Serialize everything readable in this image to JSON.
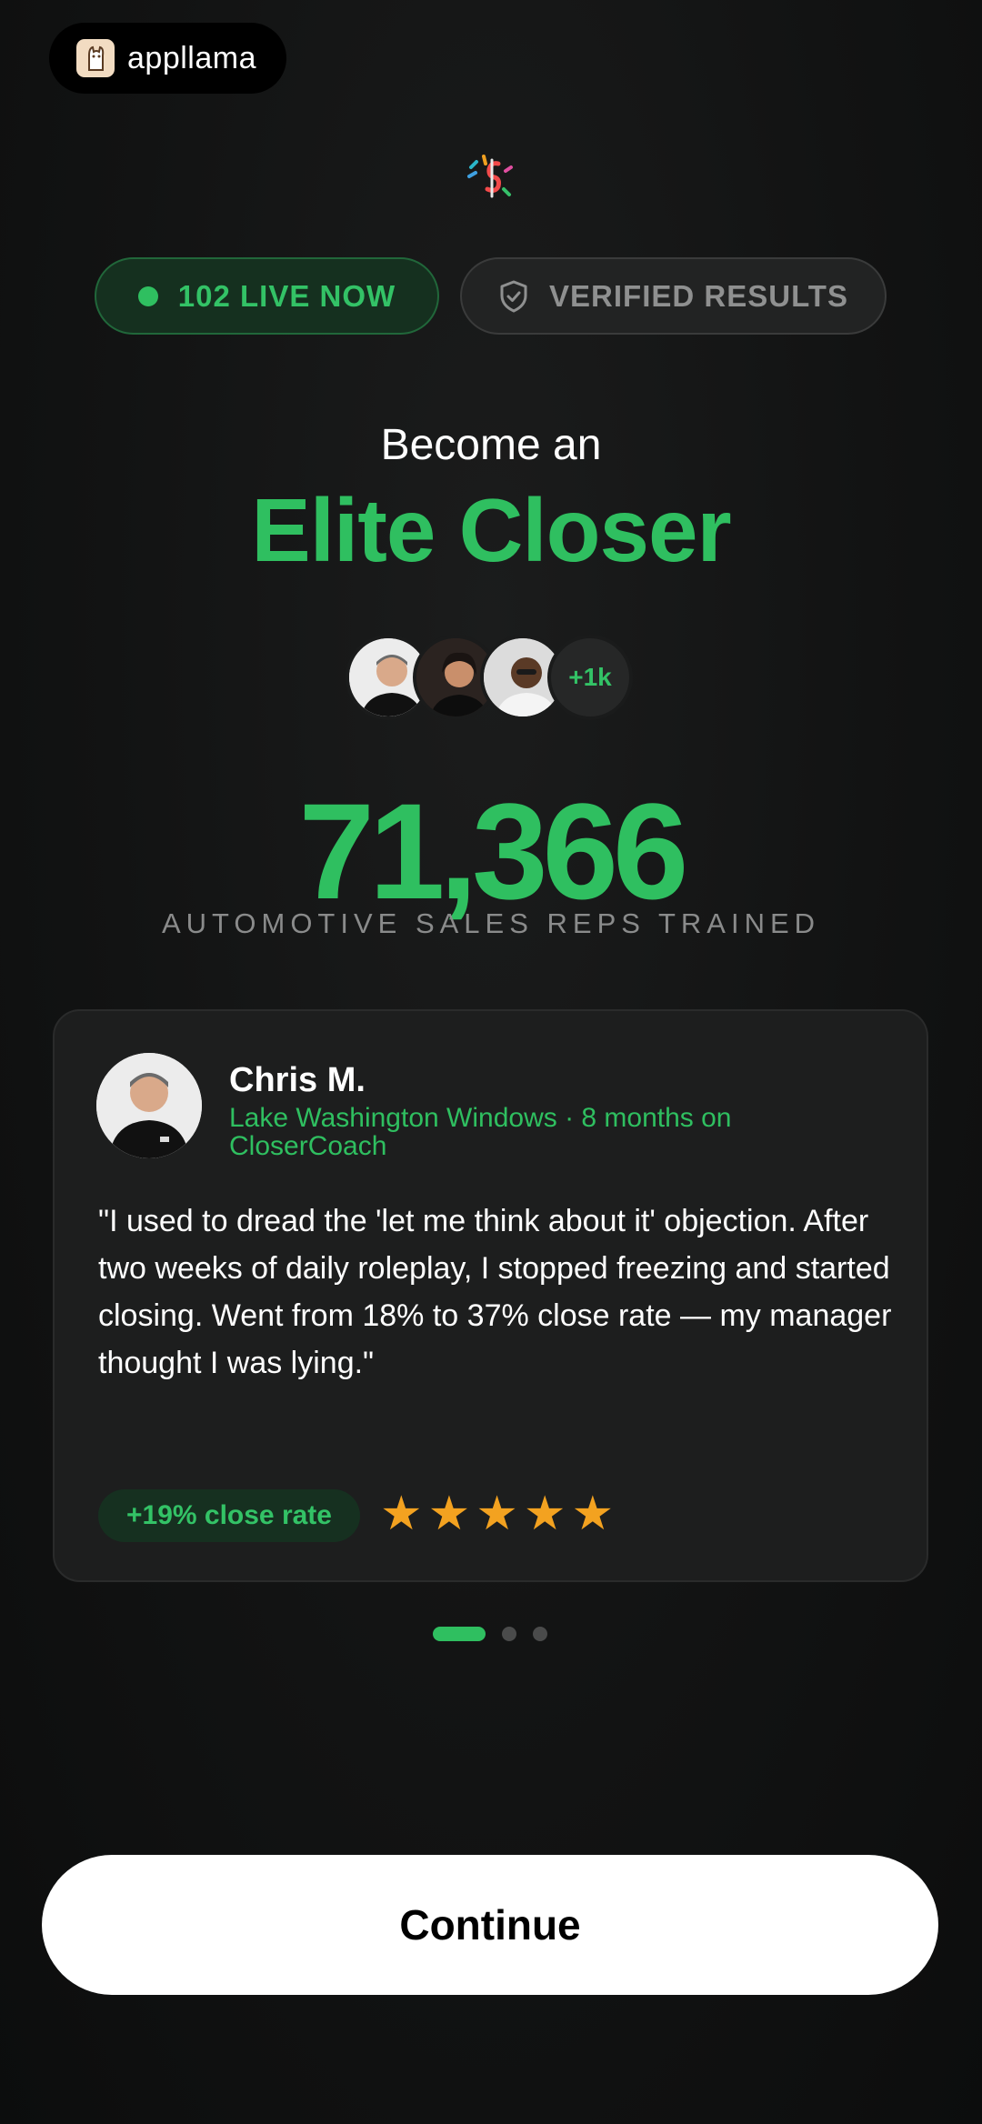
{
  "brand": {
    "name": "appllama"
  },
  "badges": {
    "live": "102 LIVE NOW",
    "verified": "VERIFIED RESULTS"
  },
  "headline": {
    "line1": "Become an",
    "line2": "Elite Closer"
  },
  "avatars": {
    "more_label": "+1k"
  },
  "stat": {
    "number": "71,366",
    "label": "AUTOMOTIVE SALES REPS TRAINED"
  },
  "testimonial": {
    "name": "Chris M.",
    "subtitle": "Lake Washington Windows · 8 months on CloserCoach",
    "quote": "\"I used to dread the 'let me think about it' objection. After two weeks of daily roleplay, I stopped freezing and started closing. Went from 18% to 37% close rate — my manager thought I was lying.\"",
    "result": "+19% close rate",
    "rating": 5
  },
  "pagination": {
    "total": 3,
    "active_index": 0
  },
  "cta": {
    "continue_label": "Continue"
  },
  "colors": {
    "accent_green": "#2fbf60",
    "star_gold": "#f3a220",
    "background": "#121313"
  }
}
